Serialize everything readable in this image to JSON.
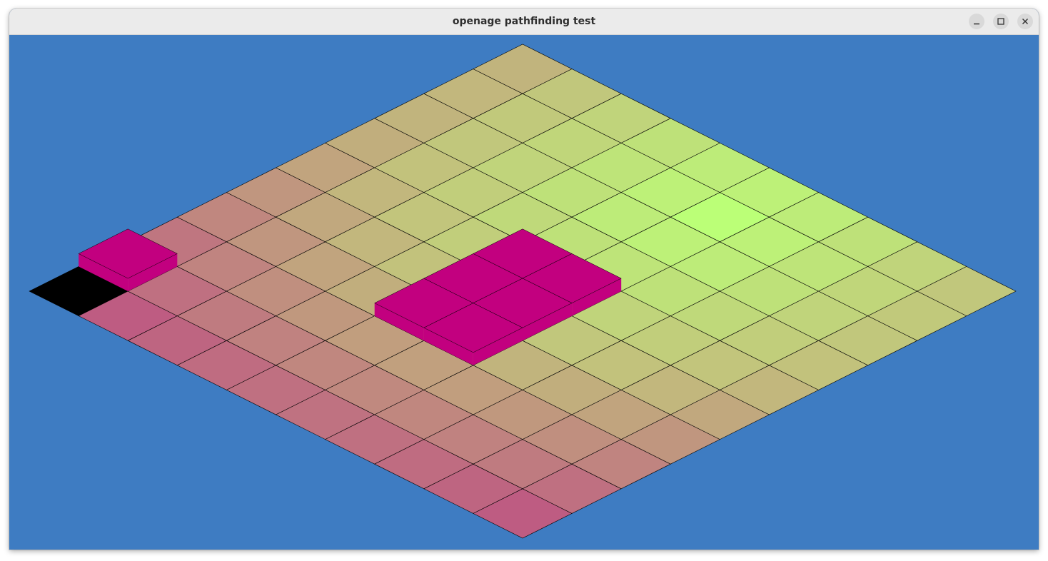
{
  "window": {
    "title": "openage pathfinding test"
  },
  "titlebar_buttons": [
    {
      "name": "minimize",
      "icon": "minimize-icon"
    },
    {
      "name": "maximize",
      "icon": "maximize-icon"
    },
    {
      "name": "close",
      "icon": "close-icon"
    }
  ],
  "colors": {
    "background": "#3e7cc2",
    "obstacle": "#c2007f",
    "start_cell": "#000000",
    "target_glow": "#bbff77",
    "far_cost": "#be5b82",
    "grid_line": "#000000"
  },
  "grid": {
    "rows": 10,
    "cols": 10,
    "start_cell": {
      "row": 0,
      "col": 0
    },
    "target_cell": {
      "row": 5,
      "col": 9
    },
    "impassable_cells": [
      {
        "row": 0,
        "col": 1
      },
      {
        "row": 4,
        "col": 3
      },
      {
        "row": 4,
        "col": 4
      },
      {
        "row": 4,
        "col": 5
      },
      {
        "row": 5,
        "col": 3
      },
      {
        "row": 5,
        "col": 4
      },
      {
        "row": 5,
        "col": 5
      }
    ]
  }
}
